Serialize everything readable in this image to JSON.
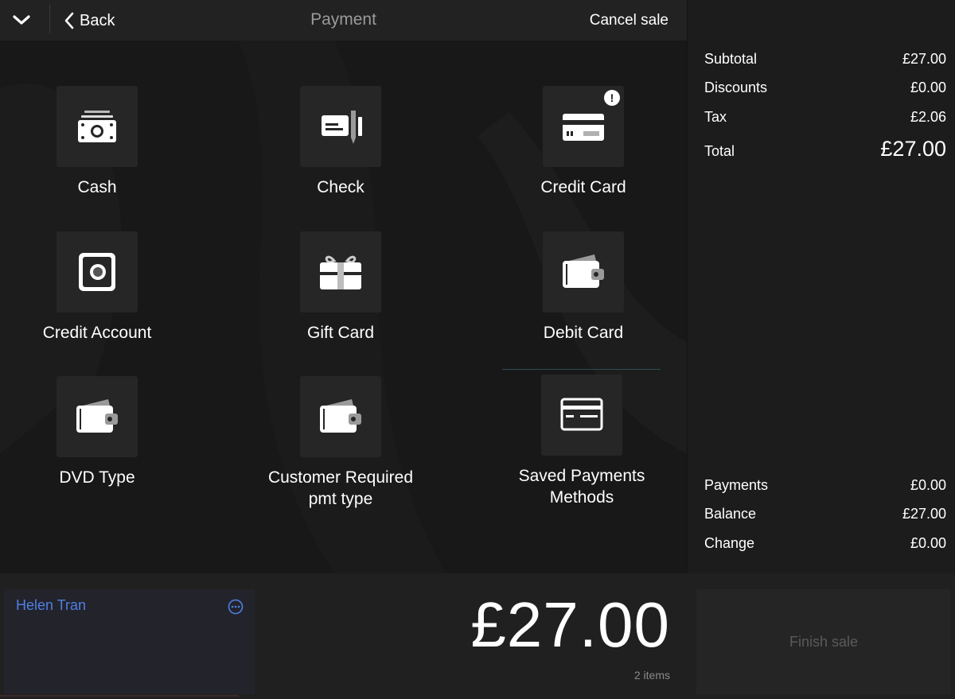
{
  "header": {
    "collapse_icon": "chevron-down-icon",
    "back_label": "Back",
    "title": "Payment",
    "cancel_label": "Cancel sale"
  },
  "payment_methods": [
    {
      "label": "Cash",
      "icon": "cash-icon"
    },
    {
      "label": "Check",
      "icon": "check-icon"
    },
    {
      "label": "Credit Card",
      "icon": "credit-card-icon",
      "alert": "!"
    },
    {
      "label": "Credit Account",
      "icon": "safe-icon"
    },
    {
      "label": "Gift Card",
      "icon": "gift-card-icon"
    },
    {
      "label": "Debit Card",
      "icon": "wallet-icon"
    },
    {
      "label": "DVD Type",
      "icon": "wallet-icon"
    },
    {
      "label": "Customer Required pmt type",
      "icon": "wallet-icon"
    },
    {
      "label": "Saved Payments Methods",
      "icon": "saved-card-icon"
    }
  ],
  "summary": {
    "subtotal_label": "Subtotal",
    "subtotal": "£27.00",
    "discounts_label": "Discounts",
    "discounts": "£0.00",
    "tax_label": "Tax",
    "tax": "£2.06",
    "total_label": "Total",
    "total": "£27.00",
    "payments_label": "Payments",
    "payments": "£0.00",
    "balance_label": "Balance",
    "balance": "£27.00",
    "change_label": "Change",
    "change": "£0.00"
  },
  "customer": {
    "name": "Helen Tran",
    "more_icon": "more-options-icon"
  },
  "footer": {
    "amount": "£27.00",
    "items": "2 items",
    "finish_label": "Finish sale"
  },
  "colors": {
    "accent_blue": "#4f7fe0",
    "background": "#181818",
    "tile": "#262626"
  }
}
